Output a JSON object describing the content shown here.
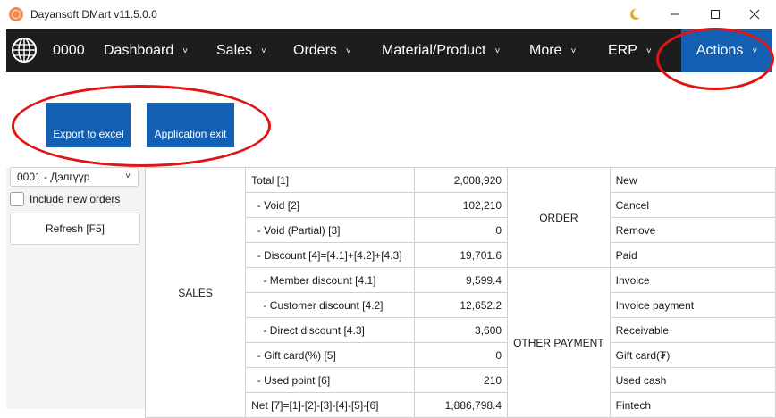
{
  "window": {
    "title": "Dayansoft DMart v11.5.0.0",
    "controls": [
      "moon-icon",
      "minimize-icon",
      "maximize-icon",
      "close-icon"
    ]
  },
  "nav": {
    "code": "0000",
    "items": [
      {
        "label": "Dashboard"
      },
      {
        "label": "Sales"
      },
      {
        "label": "Orders"
      },
      {
        "label": "Material/Product"
      },
      {
        "label": "More"
      },
      {
        "label": "ERP"
      },
      {
        "label": "Actions"
      }
    ],
    "chevron": "˅"
  },
  "actions": {
    "export_label": "Export to excel",
    "exit_label": "Application exit"
  },
  "filters": {
    "branch_value": "0001 - Дэлгүүр",
    "include_new_orders_label": "Include new orders",
    "include_new_orders_checked": false,
    "refresh_label": "Refresh [F5]"
  },
  "report": {
    "sales_label": "SALES",
    "order_label": "ORDER",
    "other_payment_label": "OTHER PAYMENT",
    "rows": [
      {
        "label": "Total [1]",
        "value": "2,008,920",
        "right": "New"
      },
      {
        "label": "  - Void [2]",
        "value": "102,210",
        "right": "Cancel"
      },
      {
        "label": "  - Void (Partial) [3]",
        "value": "0",
        "right": "Remove"
      },
      {
        "label": "  - Discount [4]=[4.1]+[4.2]+[4.3]",
        "value": "19,701.6",
        "right": "Paid"
      },
      {
        "label": "    - Member discount [4.1]",
        "value": "9,599.4",
        "right": "Invoice"
      },
      {
        "label": "    - Customer discount [4.2]",
        "value": "12,652.2",
        "right": "Invoice payment"
      },
      {
        "label": "    - Direct discount [4.3]",
        "value": "3,600",
        "right": "Receivable"
      },
      {
        "label": "  - Gift card(%) [5]",
        "value": "0",
        "right": "Gift card(₮)"
      },
      {
        "label": "  - Used point [6]",
        "value": "210",
        "right": "Used cash"
      },
      {
        "label": "Net [7]=[1]-[2]-[3]-[4]-[5]-[6]",
        "value": "1,886,798.4",
        "right": "Fintech"
      }
    ]
  }
}
